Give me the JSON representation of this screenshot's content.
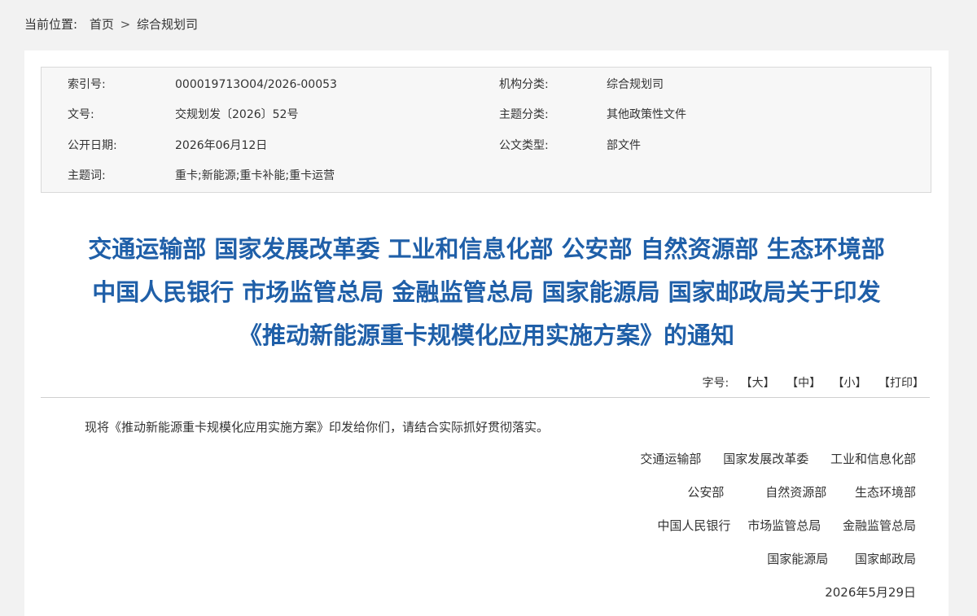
{
  "breadcrumb": {
    "prefix": "当前位置:",
    "home": "首页",
    "separator": ">",
    "current": "综合规划司"
  },
  "meta": {
    "index_label": "索引号:",
    "index_value": "000019713O04/2026-00053",
    "org_label": "机构分类:",
    "org_value": "综合规划司",
    "doc_no_label": "文号:",
    "doc_no_value": "交规划发〔2026〕52号",
    "topic_label": "主题分类:",
    "topic_value": "其他政策性文件",
    "date_label": "公开日期:",
    "date_value": "2026年06月12日",
    "type_label": "公文类型:",
    "type_value": "部文件",
    "keywords_label": "主题词:",
    "keywords_value": "重卡;新能源;重卡补能;重卡运营"
  },
  "title": {
    "line1": "交通运输部 国家发展改革委 工业和信息化部 公安部 自然资源部 生态环境部",
    "line2": "中国人民银行 市场监管总局 金融监管总局 国家能源局 国家邮政局关于印发",
    "line3": "《推动新能源重卡规模化应用实施方案》的通知"
  },
  "font_tools": {
    "label": "字号:",
    "large": "【大】",
    "medium": "【中】",
    "small": "【小】",
    "print": "【打印】"
  },
  "body": {
    "paragraph": "现将《推动新能源重卡规模化应用实施方案》印发给你们，请结合实际抓好贯彻落实。"
  },
  "signatories": {
    "row1": [
      "交通运输部",
      "国家发展改革委",
      "工业和信息化部"
    ],
    "row2": [
      "公安部",
      "自然资源部",
      "生态环境部"
    ],
    "row3": [
      "中国人民银行",
      "市场监管总局",
      "金融监管总局"
    ],
    "row4": [
      "国家能源局",
      "国家邮政局"
    ],
    "date": "2026年5月29日"
  },
  "colors": {
    "title": "#1f5fa8",
    "page_bg": "#f2f2f2",
    "meta_bg": "#f7f7f7"
  }
}
